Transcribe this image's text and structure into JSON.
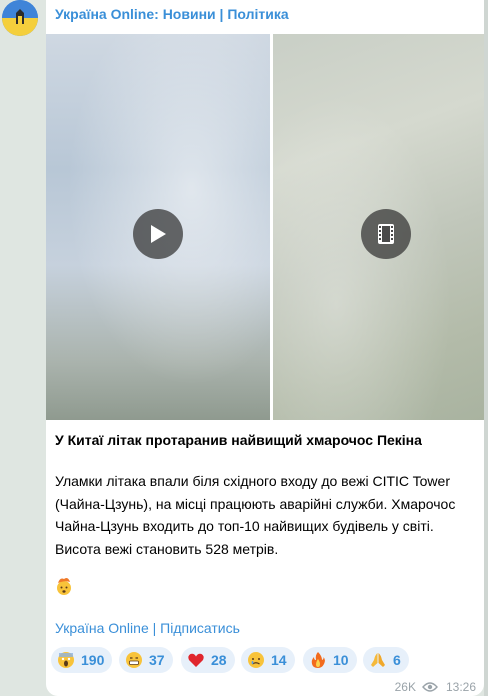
{
  "channel": {
    "name": "Україна Online: Новини | Політика"
  },
  "post": {
    "title": "У Китаї літак протаранив найвищий хмарочос Пекіна",
    "body": "Уламки літака впали біля східного входу до вежі CITIC Tower (Чайна-Цзунь), на місці працюють аварійні служби. Хмарочос Чайна-Цзунь входить до топ-10 найвищих будівель у світі. Висота вежі становить 528 метрів.",
    "trailing_emoji": "exploding-head-emoji",
    "subscribe_link": "Україна Online | Підписатись"
  },
  "reactions": [
    {
      "icon": "scream-emoji",
      "count": "190"
    },
    {
      "icon": "grin-emoji",
      "count": "37"
    },
    {
      "icon": "heart-emoji",
      "count": "28"
    },
    {
      "icon": "crying-emoji",
      "count": "14"
    },
    {
      "icon": "fire-emoji",
      "count": "10"
    },
    {
      "icon": "praying-hands-emoji",
      "count": "6"
    }
  ],
  "meta": {
    "views": "26K",
    "time": "13:26"
  },
  "colors": {
    "accent": "#3a8fd8",
    "reaction_bg": "#e7f0fa",
    "chat_bg": "#dfe6e1"
  }
}
